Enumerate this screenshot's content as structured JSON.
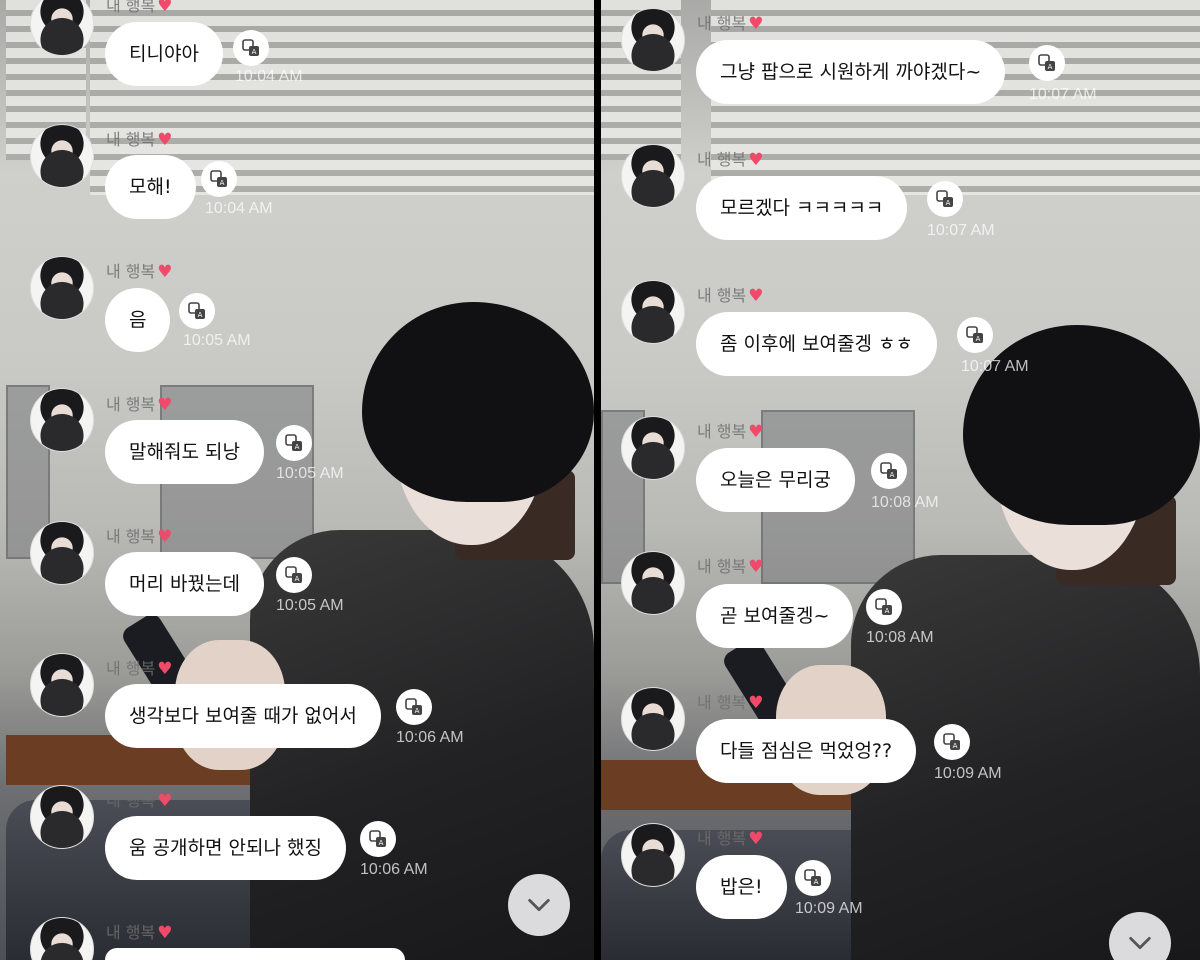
{
  "sender_name": "내 행복",
  "heart": "♥",
  "colors": {
    "bubble": "#ffffff",
    "heart": "#f04a6a",
    "timestamp": "#ffffff"
  },
  "icons": {
    "translate": "translate-icon",
    "scroll": "chevron-down-icon",
    "avatar": "avatar"
  },
  "left_panel": {
    "messages": [
      {
        "text": "티니야아",
        "time": "10:04 AM"
      },
      {
        "text": "모해!",
        "time": "10:04 AM"
      },
      {
        "text": "음",
        "time": "10:05 AM"
      },
      {
        "text": "말해줘도 되낭",
        "time": "10:05 AM"
      },
      {
        "text": "머리 바꿨는데",
        "time": "10:05 AM"
      },
      {
        "text": "생각보다 보여줄 때가 없어서",
        "time": "10:06 AM"
      },
      {
        "text": "움 공개하면 안되나 했징",
        "time": "10:06 AM"
      }
    ]
  },
  "right_panel": {
    "messages": [
      {
        "text": "그냥 팝으로 시원하게 까야겠다~",
        "time": "10:07 AM"
      },
      {
        "text": "모르겠다 ㅋㅋㅋㅋㅋ",
        "time": "10:07 AM"
      },
      {
        "text": "좀 이후에 보여줄겡 ㅎㅎ",
        "time": "10:07 AM"
      },
      {
        "text": "오늘은 무리궁",
        "time": "10:08 AM"
      },
      {
        "text": "곧 보여줄겡~",
        "time": "10:08 AM"
      },
      {
        "text": "다들 점심은 먹었엉??",
        "time": "10:09 AM"
      },
      {
        "text": "밥은!",
        "time": "10:09 AM"
      }
    ]
  }
}
